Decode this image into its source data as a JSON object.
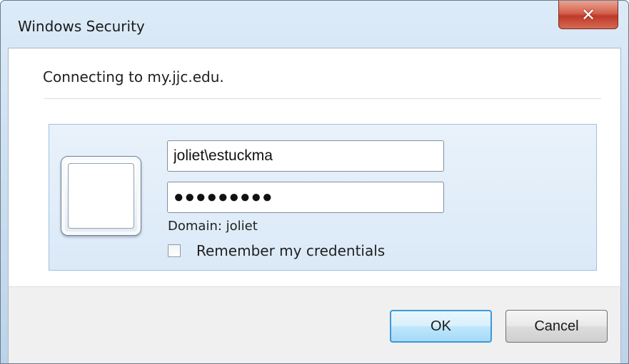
{
  "window": {
    "title": "Windows Security",
    "close_icon": "close-icon",
    "close_glyph": "✕"
  },
  "content": {
    "connecting_text": "Connecting to my.jjc.edu."
  },
  "credentials": {
    "user_icon": "user-tile-icon",
    "username_value": "joliet\\estuckma",
    "password_masked": "●●●●●●●●●",
    "domain_text": "Domain: joliet",
    "remember_label": "Remember my credentials",
    "remember_checked": false
  },
  "buttons": {
    "ok_label": "OK",
    "cancel_label": "Cancel"
  },
  "colors": {
    "accent": "#3c9ad6",
    "close_red": "#c0392b",
    "tile_blue": "#dbe9f7"
  }
}
